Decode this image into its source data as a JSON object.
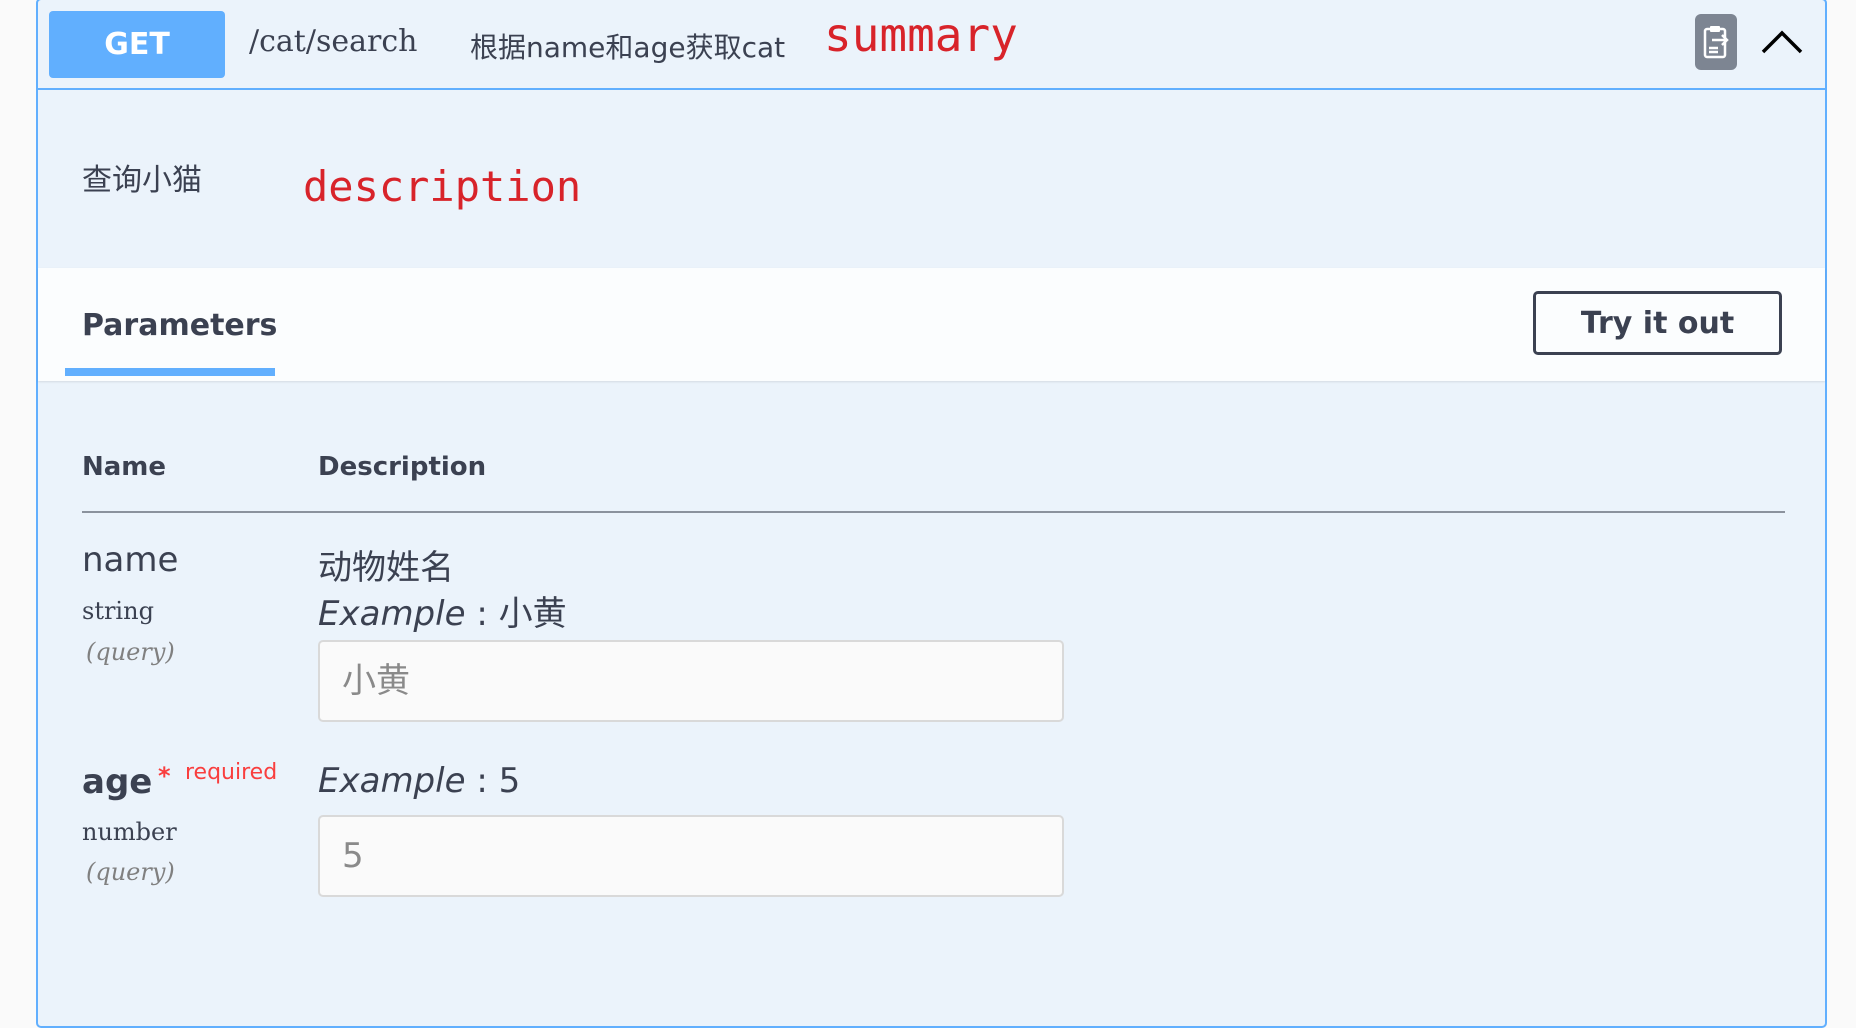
{
  "operation": {
    "method": "GET",
    "path": "/cat/search",
    "summary": "根据name和age获取cat",
    "description": "查询小猫"
  },
  "annotations": {
    "summary": "summary",
    "description": "description"
  },
  "icons": {
    "copy": "clipboard-icon",
    "collapse": "chevron-up-icon"
  },
  "colors": {
    "method_bg": "#61affe",
    "block_bg": "#ebf3fb",
    "annotation": "#d8232a",
    "required": "#f93e3e"
  },
  "parameters_section": {
    "tab_label": "Parameters",
    "try_button_label": "Try it out",
    "columns": {
      "name": "Name",
      "description": "Description"
    }
  },
  "parameters": [
    {
      "name": "name",
      "type": "string",
      "in": "(query)",
      "description": "动物姓名",
      "example_label": "Example",
      "example_sep": " : ",
      "example_value": "小黄",
      "placeholder": "小黄"
    },
    {
      "name": "age",
      "required_mark": "*",
      "required_label": "required",
      "type": "number",
      "in": "(query)",
      "example_label": "Example",
      "example_sep": " : ",
      "example_value": "5",
      "placeholder": "5"
    }
  ]
}
